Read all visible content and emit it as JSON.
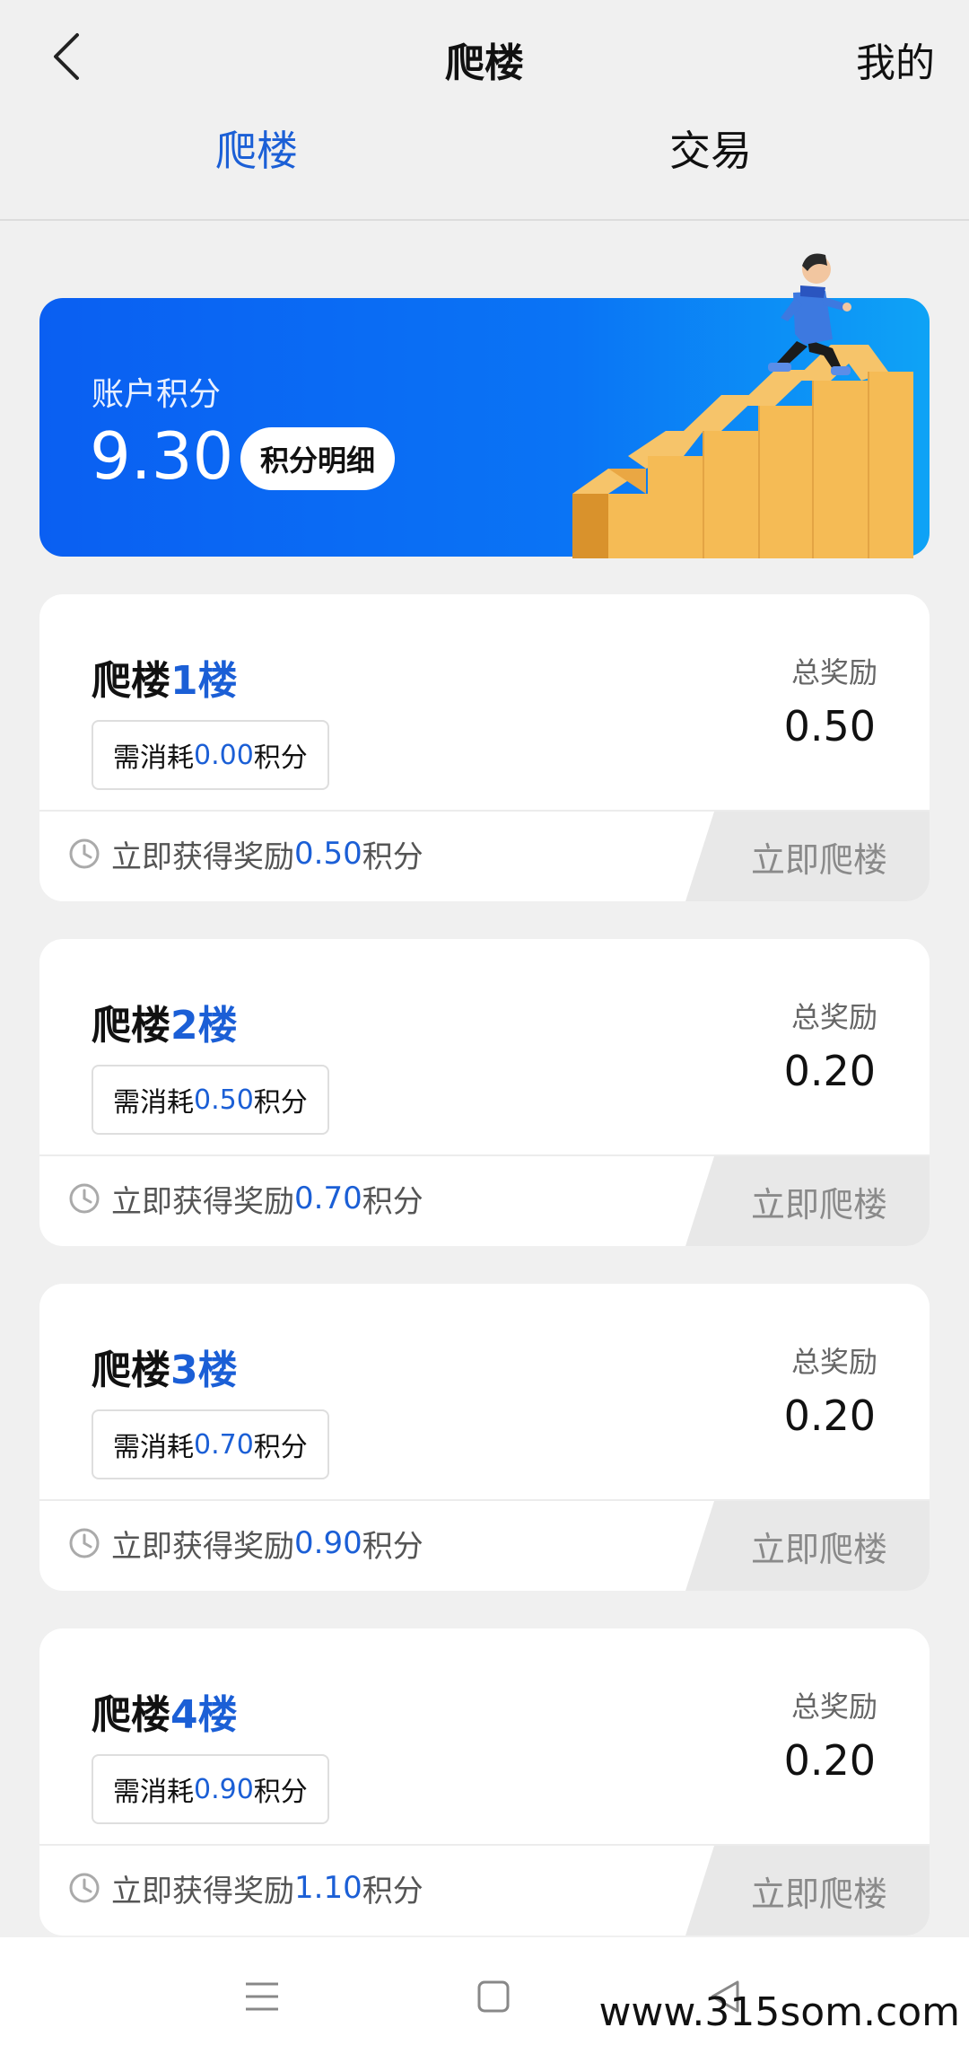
{
  "header": {
    "title": "爬楼",
    "mine": "我的",
    "tabs": [
      {
        "label": "爬楼",
        "active": true
      },
      {
        "label": "交易",
        "active": false
      }
    ]
  },
  "account": {
    "label": "账户积分",
    "points": "9.30",
    "detail_button": "积分明细"
  },
  "floors": [
    {
      "title": "爬楼",
      "num": "1楼",
      "cost_prefix": "需消耗",
      "cost": "0.00",
      "cost_suffix": "积分",
      "reward_label": "总奖励",
      "reward": "0.50",
      "instant_prefix": "立即获得奖励",
      "instant": "0.50",
      "instant_suffix": "积分",
      "button": "立即爬楼"
    },
    {
      "title": "爬楼",
      "num": "2楼",
      "cost_prefix": "需消耗",
      "cost": "0.50",
      "cost_suffix": "积分",
      "reward_label": "总奖励",
      "reward": "0.20",
      "instant_prefix": "立即获得奖励",
      "instant": "0.70",
      "instant_suffix": "积分",
      "button": "立即爬楼"
    },
    {
      "title": "爬楼",
      "num": "3楼",
      "cost_prefix": "需消耗",
      "cost": "0.70",
      "cost_suffix": "积分",
      "reward_label": "总奖励",
      "reward": "0.20",
      "instant_prefix": "立即获得奖励",
      "instant": "0.90",
      "instant_suffix": "积分",
      "button": "立即爬楼"
    },
    {
      "title": "爬楼",
      "num": "4楼",
      "cost_prefix": "需消耗",
      "cost": "0.90",
      "cost_suffix": "积分",
      "reward_label": "总奖励",
      "reward": "0.20",
      "instant_prefix": "立即获得奖励",
      "instant": "1.10",
      "instant_suffix": "积分",
      "button": "立即爬楼"
    }
  ],
  "colors": {
    "accent": "#1b5fd6",
    "banner_start": "#0a5ff2",
    "banner_end": "#0ea3f6",
    "button_bg": "#e8e8e8"
  },
  "icons": {
    "back": "chevron-left-icon",
    "clock": "clock-icon",
    "nav_menu": "menu-icon",
    "nav_home": "square-icon",
    "nav_back": "triangle-back-icon"
  },
  "watermark": "www.315som.com"
}
